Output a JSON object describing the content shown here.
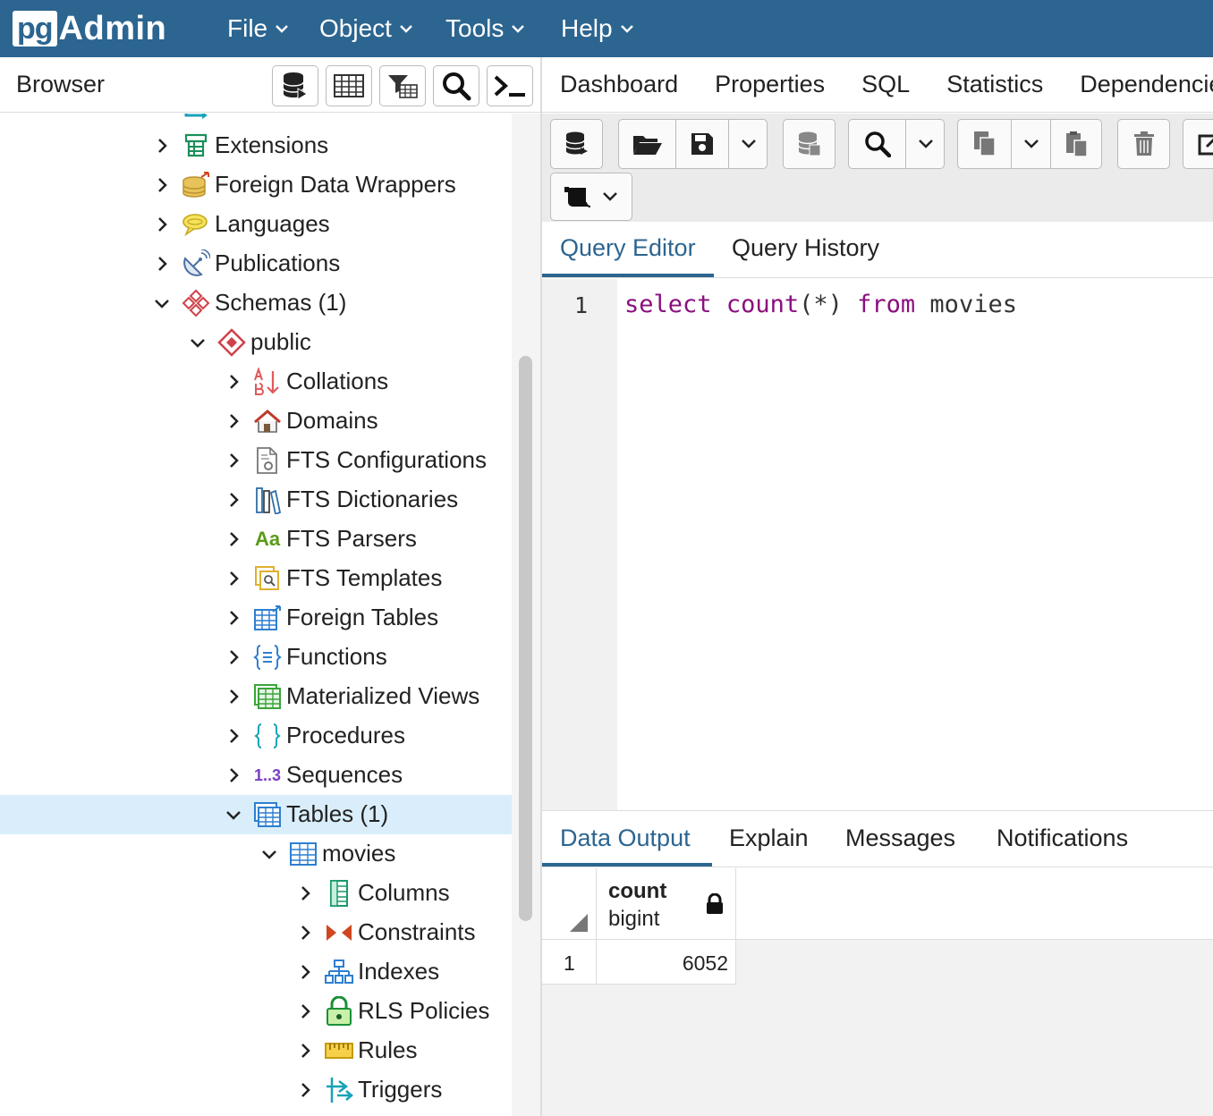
{
  "app": {
    "logo_pg": "pg",
    "logo_admin": "Admin"
  },
  "menu": [
    {
      "label": "File"
    },
    {
      "label": "Object"
    },
    {
      "label": "Tools"
    },
    {
      "label": "Help"
    }
  ],
  "browser": {
    "title": "Browser",
    "toolbar_icons": [
      "database-query-icon",
      "table-grid-icon",
      "filter-table-icon",
      "search-icon",
      "terminal-icon"
    ]
  },
  "tree": [
    {
      "label": "Extensions",
      "icon": "extensions-icon"
    },
    {
      "label": "Foreign Data Wrappers",
      "icon": "foreign-data-wrappers-icon"
    },
    {
      "label": "Languages",
      "icon": "languages-icon"
    },
    {
      "label": "Publications",
      "icon": "publications-icon"
    },
    {
      "label": "Schemas (1)",
      "icon": "schemas-icon",
      "expanded": true
    },
    {
      "label": "public",
      "icon": "schema-public-icon",
      "expanded": true
    },
    {
      "label": "Collations",
      "icon": "collations-icon"
    },
    {
      "label": "Domains",
      "icon": "domains-icon"
    },
    {
      "label": "FTS Configurations",
      "icon": "fts-configurations-icon"
    },
    {
      "label": "FTS Dictionaries",
      "icon": "fts-dictionaries-icon"
    },
    {
      "label": "FTS Parsers",
      "icon": "fts-parsers-icon"
    },
    {
      "label": "FTS Templates",
      "icon": "fts-templates-icon"
    },
    {
      "label": "Foreign Tables",
      "icon": "foreign-tables-icon"
    },
    {
      "label": "Functions",
      "icon": "functions-icon"
    },
    {
      "label": "Materialized Views",
      "icon": "materialized-views-icon"
    },
    {
      "label": "Procedures",
      "icon": "procedures-icon"
    },
    {
      "label": "Sequences",
      "icon": "sequences-icon"
    },
    {
      "label": "Tables (1)",
      "icon": "tables-icon",
      "expanded": true,
      "selected": true
    },
    {
      "label": "movies",
      "icon": "table-icon",
      "expanded": true
    },
    {
      "label": "Columns",
      "icon": "columns-icon"
    },
    {
      "label": "Constraints",
      "icon": "constraints-icon"
    },
    {
      "label": "Indexes",
      "icon": "indexes-icon"
    },
    {
      "label": "RLS Policies",
      "icon": "rls-policies-icon"
    },
    {
      "label": "Rules",
      "icon": "rules-icon"
    },
    {
      "label": "Triggers",
      "icon": "triggers-icon"
    }
  ],
  "tree_icon_glyphs": {
    "fts_parsers": "Aa",
    "sequences": "1..3"
  },
  "main_tabs": [
    {
      "label": "Dashboard"
    },
    {
      "label": "Properties"
    },
    {
      "label": "SQL"
    },
    {
      "label": "Statistics"
    },
    {
      "label": "Dependencies"
    }
  ],
  "editor_tabs": [
    {
      "label": "Query Editor",
      "active": true
    },
    {
      "label": "Query History"
    }
  ],
  "editor": {
    "line_number": "1",
    "tokens": [
      {
        "text": "select",
        "kind": "keyword"
      },
      {
        "text": " ",
        "kind": "plain"
      },
      {
        "text": "count",
        "kind": "keyword"
      },
      {
        "text": "(*)",
        "kind": "plain"
      },
      {
        "text": " ",
        "kind": "plain"
      },
      {
        "text": "from",
        "kind": "keyword"
      },
      {
        "text": " movies",
        "kind": "plain"
      }
    ]
  },
  "output_tabs": [
    {
      "label": "Data Output",
      "active": true
    },
    {
      "label": "Explain"
    },
    {
      "label": "Messages"
    },
    {
      "label": "Notifications"
    }
  ],
  "result": {
    "column": {
      "name": "count",
      "type": "bigint"
    },
    "rows": [
      {
        "num": "1",
        "value": "6052"
      }
    ]
  },
  "colors": {
    "accent": "#2c6590",
    "keyword": "#8a0f7e",
    "selected_row": "#d9eefa"
  }
}
